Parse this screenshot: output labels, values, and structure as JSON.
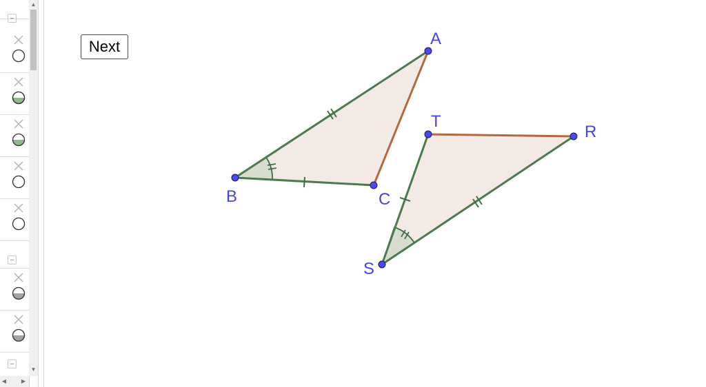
{
  "toolbar": {
    "next_label": "Next"
  },
  "colors": {
    "accent": "#4545e0",
    "segment_green": "#4b7a4e",
    "segment_brown": "#b5683f",
    "triangle_fill": "#f3e9e5",
    "angle_fill": "#d8dccf",
    "point_fill": "#4545e0"
  },
  "sidebar": {
    "groups": [
      {
        "items": [
          {
            "icon": "visibility-toggle-empty-icon",
            "state": "hidden"
          },
          {
            "icon": "visibility-toggle-green-icon",
            "state": "shown"
          },
          {
            "icon": "visibility-toggle-green-icon",
            "state": "shown"
          },
          {
            "icon": "visibility-toggle-empty-icon",
            "state": "hidden"
          },
          {
            "icon": "visibility-toggle-empty-icon",
            "state": "hidden"
          }
        ]
      },
      {
        "items": [
          {
            "icon": "visibility-toggle-gray-icon",
            "state": "shown"
          },
          {
            "icon": "visibility-toggle-gray-icon",
            "state": "shown"
          }
        ]
      },
      {
        "items": []
      }
    ]
  },
  "figure": {
    "points": [
      {
        "name": "A"
      },
      {
        "name": "B"
      },
      {
        "name": "C"
      },
      {
        "name": "T"
      },
      {
        "name": "R"
      },
      {
        "name": "S"
      }
    ],
    "triangles": [
      {
        "name": "ABC",
        "vertices": [
          "A",
          "B",
          "C"
        ]
      },
      {
        "name": "TSR",
        "vertices": [
          "T",
          "S",
          "R"
        ]
      }
    ],
    "segments": [
      {
        "from": "B",
        "to": "A",
        "ticks": 2,
        "color": "green"
      },
      {
        "from": "B",
        "to": "C",
        "ticks": 1,
        "color": "green"
      },
      {
        "from": "A",
        "to": "C",
        "ticks": 0,
        "color": "brown"
      },
      {
        "from": "S",
        "to": "R",
        "ticks": 2,
        "color": "green"
      },
      {
        "from": "S",
        "to": "T",
        "ticks": 1,
        "color": "green"
      },
      {
        "from": "T",
        "to": "R",
        "ticks": 0,
        "color": "brown"
      }
    ],
    "angles": [
      {
        "vertex": "B",
        "ticks": 2
      },
      {
        "vertex": "S",
        "ticks": 2
      }
    ]
  }
}
